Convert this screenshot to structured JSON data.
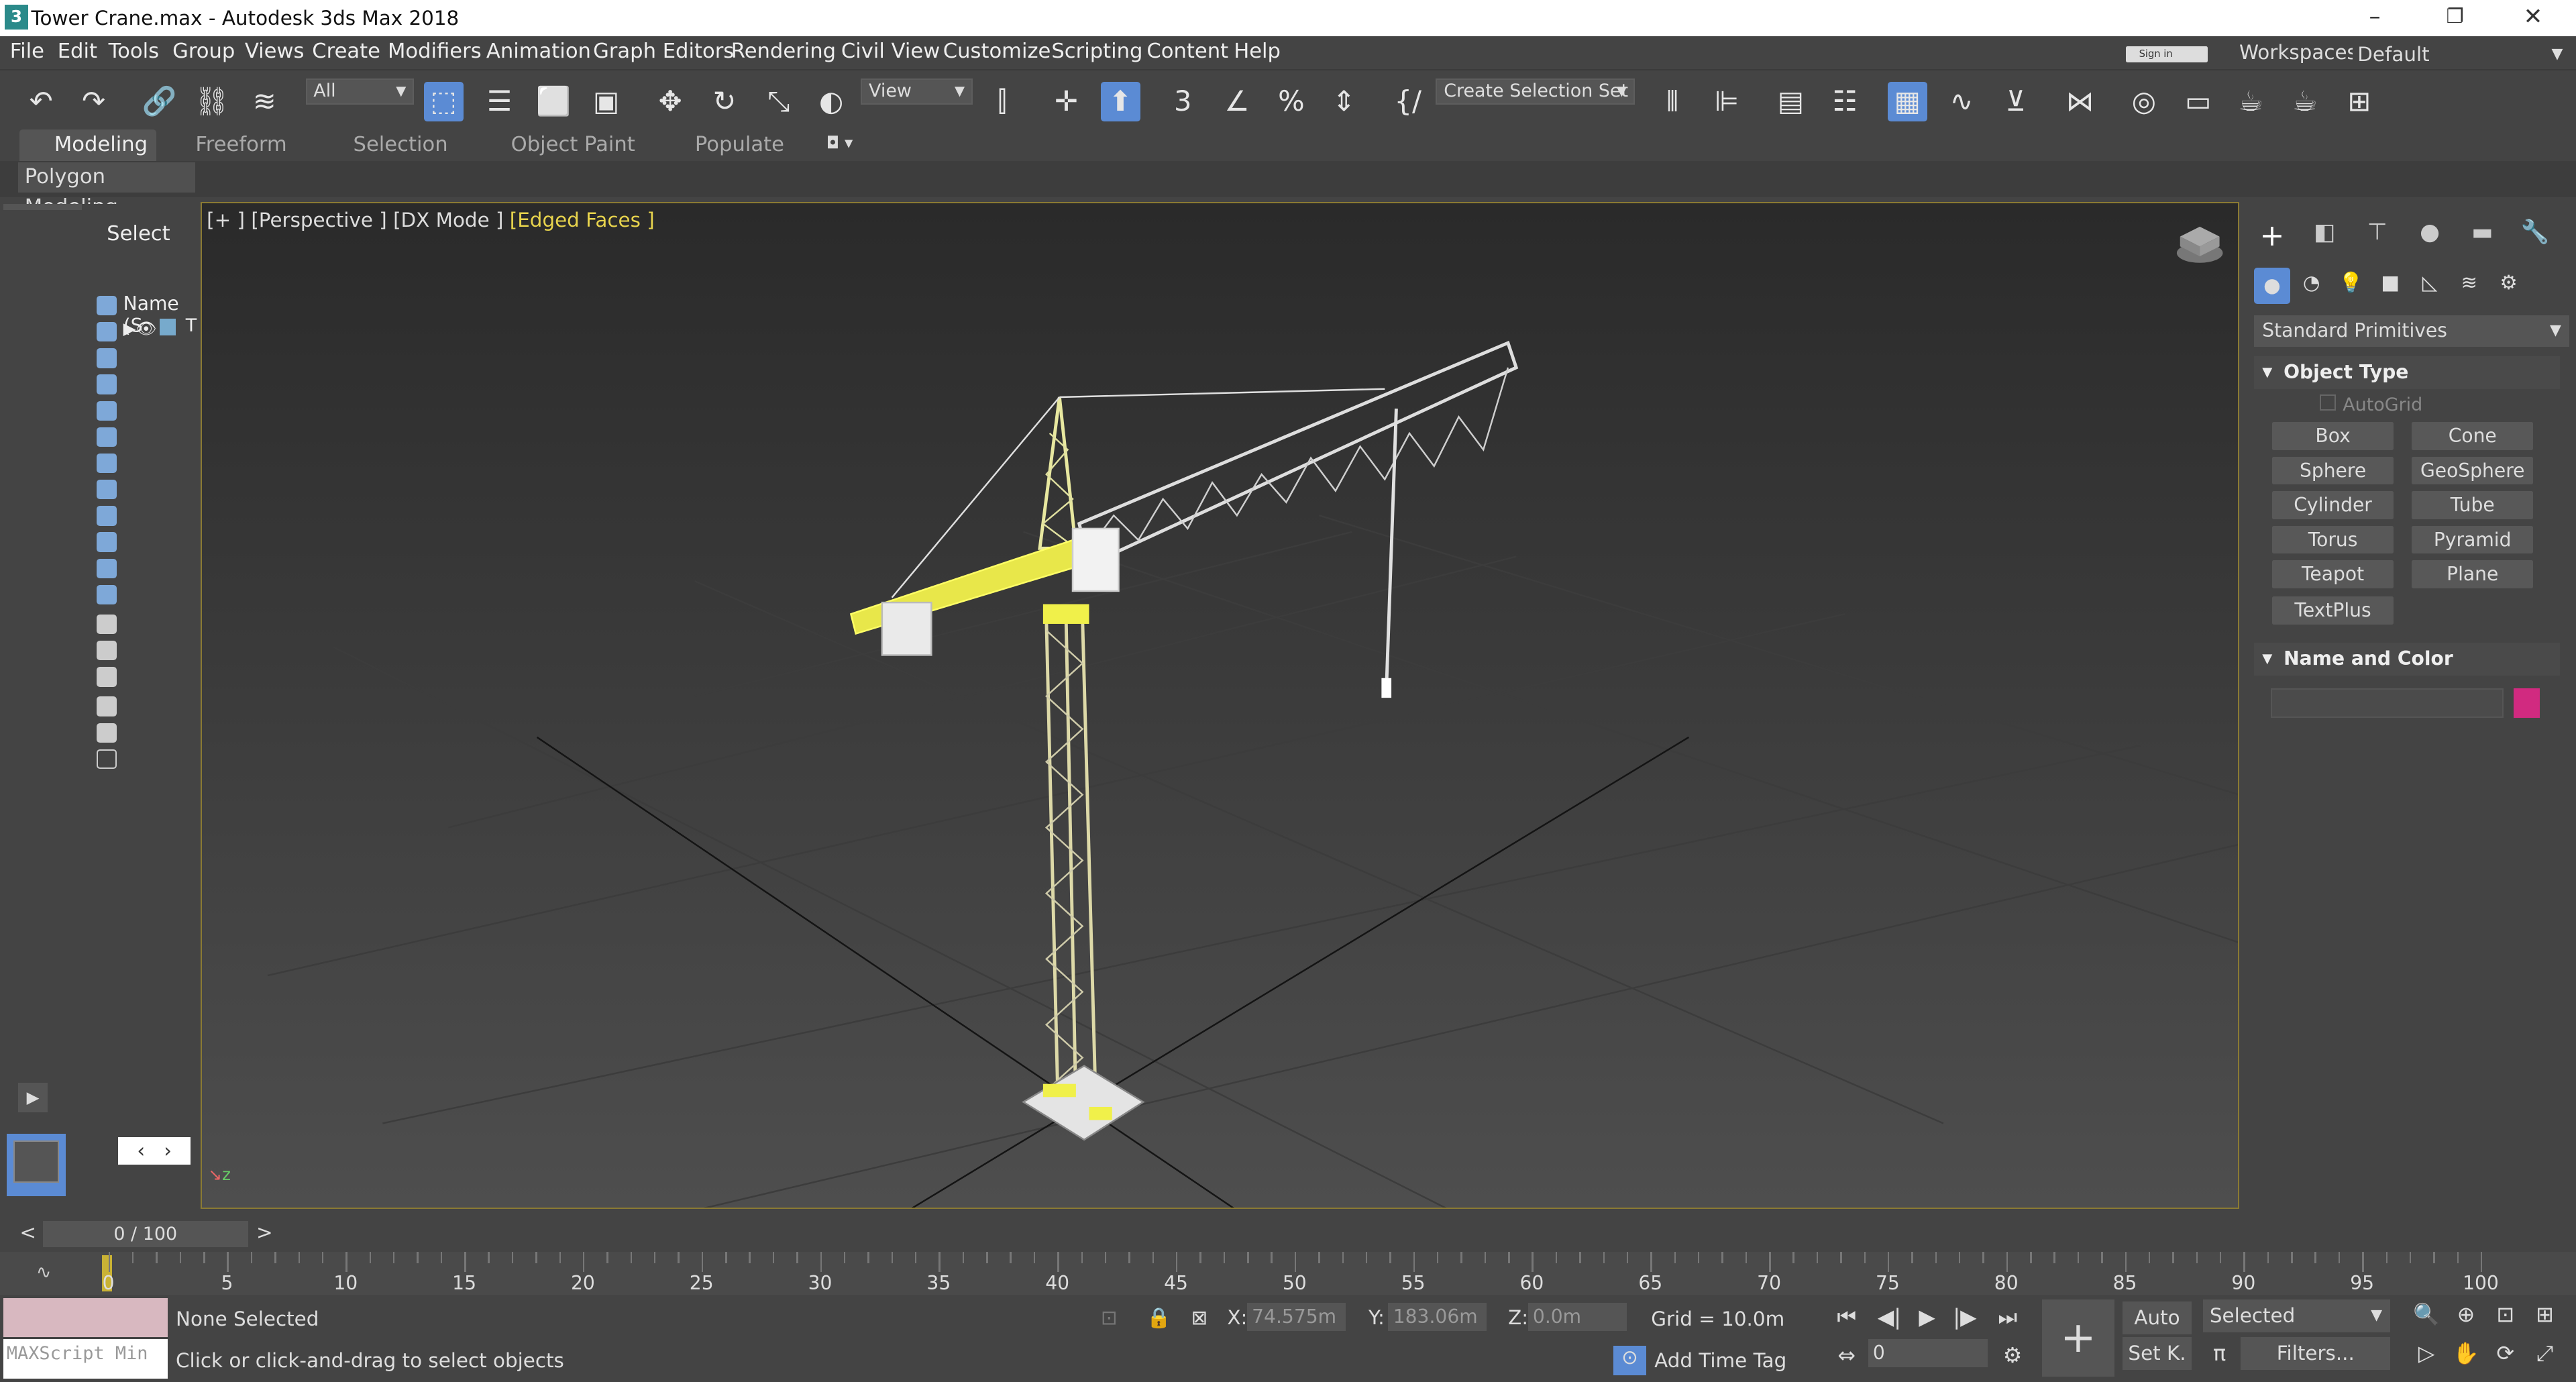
{
  "window": {
    "title": "Tower Crane.max - Autodesk 3ds Max 2018",
    "app_icon": "3"
  },
  "menu": [
    "File",
    "Edit",
    "Tools",
    "Group",
    "Views",
    "Create",
    "Modifiers",
    "Animation",
    "Graph Editors",
    "Rendering",
    "Civil View",
    "Customize",
    "Scripting",
    "Content",
    "Help"
  ],
  "signin": "Sign in",
  "workspace": {
    "label": "Workspaces:",
    "value": "Default"
  },
  "toolbar": {
    "filter": "All",
    "refcoord": "View",
    "selset": "Create Selection Set"
  },
  "ribbon": {
    "tabs": [
      "Modeling",
      "Freeform",
      "Selection",
      "Object Paint",
      "Populate"
    ],
    "sub": "Polygon Modeling"
  },
  "scene_explorer": {
    "header": "Select",
    "column": "Name (S",
    "row": "T"
  },
  "viewport": {
    "label_plus": "[+ ]",
    "label_view": "[Perspective ]",
    "label_mode": "[DX Mode ]",
    "label_shade": "[Edged Faces ]"
  },
  "command_panel": {
    "category": "Standard Primitives",
    "object_type": "Object Type",
    "autogrid": "AutoGrid",
    "buttons": [
      "Box",
      "Cone",
      "Sphere",
      "GeoSphere",
      "Cylinder",
      "Tube",
      "Torus",
      "Pyramid",
      "Teapot",
      "Plane",
      "TextPlus"
    ],
    "name_color": "Name and Color",
    "object_color": "#d12a80"
  },
  "time": {
    "slider": "0 / 100",
    "ticks": [
      "0",
      "5",
      "10",
      "15",
      "20",
      "25",
      "30",
      "35",
      "40",
      "45",
      "50",
      "55",
      "60",
      "65",
      "70",
      "75",
      "80",
      "85",
      "90",
      "95",
      "100"
    ]
  },
  "status": {
    "selection": "None Selected",
    "prompt": "Click or click-and-drag to select objects",
    "maxscript": "MAXScript Min",
    "x_label": "X:",
    "x": "74.575m",
    "y_label": "Y:",
    "y": "183.06m",
    "z_label": "Z:",
    "z": "0.0m",
    "grid": "Grid = 10.0m",
    "add_time_tag": "Add Time Tag",
    "auto": "Auto",
    "setk": "Set K.",
    "selected": "Selected",
    "frame": "0",
    "filters": "Filters..."
  }
}
